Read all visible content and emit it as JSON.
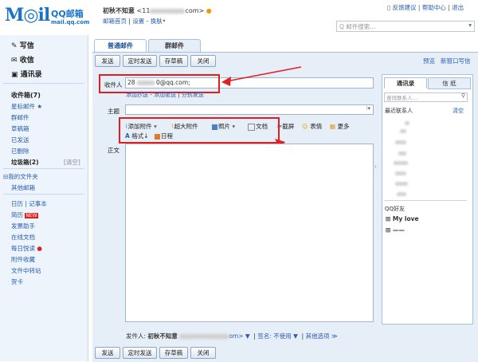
{
  "logo": {
    "mark": "M◎il",
    "name": "QQ邮箱",
    "domain": "mail.qq.com"
  },
  "user": {
    "name": "初秋不知意",
    "email_prefix": "<11",
    "email_suffix": "com>",
    "links": [
      "邮箱首页",
      "设置",
      "换肤"
    ]
  },
  "top_links": [
    "反馈建议",
    "帮助中心",
    "退出"
  ],
  "search_placeholder": "Q 邮件搜索...",
  "nav": {
    "write": "写信",
    "inbox": "收信",
    "contacts": "通讯录",
    "items": [
      "收件箱(7)",
      "星标邮件 ★",
      "群邮件",
      "草稿箱",
      "已发送",
      "已删除",
      "垃圾箱(2)"
    ],
    "clear": "[清空]",
    "folders": [
      "⊟我的文件夹",
      "其他邮箱"
    ],
    "apps": [
      "日历 | 记事本",
      "简历",
      "发票助手",
      "在线文档",
      "每日悦读",
      "附件收藏",
      "文件中转站",
      "贺卡"
    ],
    "new_badge": "NEW"
  },
  "tabs": [
    "普通邮件",
    "群邮件"
  ],
  "toolbar": [
    "发送",
    "定时发送",
    "存草稿",
    "关闭"
  ],
  "preview_links": [
    "预览",
    "新窗口写信"
  ],
  "compose": {
    "to_label": "收件人",
    "to_prefix": "28",
    "to_suffix": "0@qq.com;",
    "cc_links": [
      "添加抄送",
      "添加密送",
      "分别发送"
    ],
    "subject_label": "主题",
    "body_label": "正文",
    "tools_row1": [
      "添加附件",
      "超大附件",
      "照片",
      "文档",
      "截屏",
      "表情",
      "更多"
    ],
    "tools_row2": [
      "格式",
      "日程"
    ]
  },
  "contacts_panel": {
    "tabs": [
      "通讯录",
      "信 纸"
    ],
    "search_placeholder": "查找联系人...",
    "recent": "最近联系人",
    "clear": "清空",
    "qq_friends": "QQ好友",
    "groups": [
      "My love",
      "——"
    ]
  },
  "footer": {
    "sender_label": "发件人:",
    "sender_name": "初秋不知意",
    "sender_suffix": "om> ▼",
    "signature": "签名: 不使用 ▼",
    "options": "其他选项 ≫"
  }
}
